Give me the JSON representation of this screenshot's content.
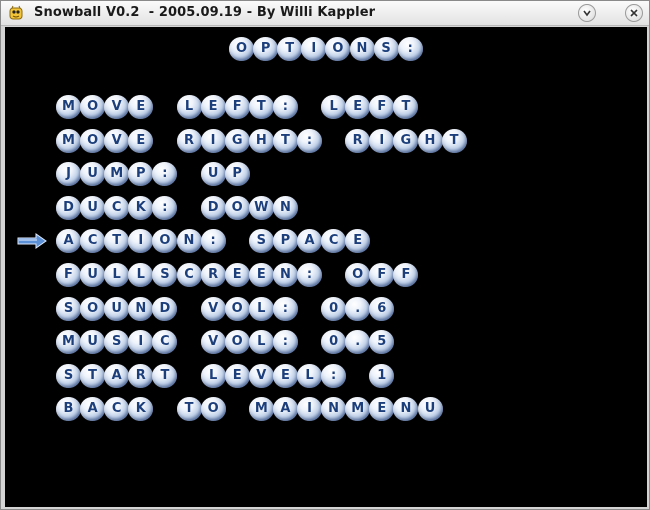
{
  "window": {
    "title": "Snowball V0.2  - 2005.09.19 - By Willi Kappler",
    "app_icon": "snowball-game-icon",
    "buttons": [
      "menu-chevron-icon",
      "close-x-icon"
    ]
  },
  "colors": {
    "background": "#000000",
    "ball_highlight": "#ffffff",
    "ball_shade": "#4e6a98",
    "letter": "#1c3f7c",
    "cursor": "#5b8fd6"
  },
  "menu": {
    "title": "OPTIONS:",
    "selected_index": 4,
    "cursor_icon": "arrow-right-icon",
    "items": [
      {
        "label": "MOVE LEFT:",
        "value": "LEFT"
      },
      {
        "label": "MOVE RIGHT:",
        "value": "RIGHT"
      },
      {
        "label": "JUMP:",
        "value": "UP"
      },
      {
        "label": "DUCK:",
        "value": "DOWN"
      },
      {
        "label": "ACTION:",
        "value": "SPACE"
      },
      {
        "label": "FULLSCREEN:",
        "value": "OFF"
      },
      {
        "label": "SOUND VOL:",
        "value": "0.6"
      },
      {
        "label": "MUSIC VOL:",
        "value": "0.5"
      },
      {
        "label": "START LEVEL:",
        "value": "1"
      },
      {
        "label": "BACK TO MAINMENU",
        "value": ""
      }
    ]
  }
}
